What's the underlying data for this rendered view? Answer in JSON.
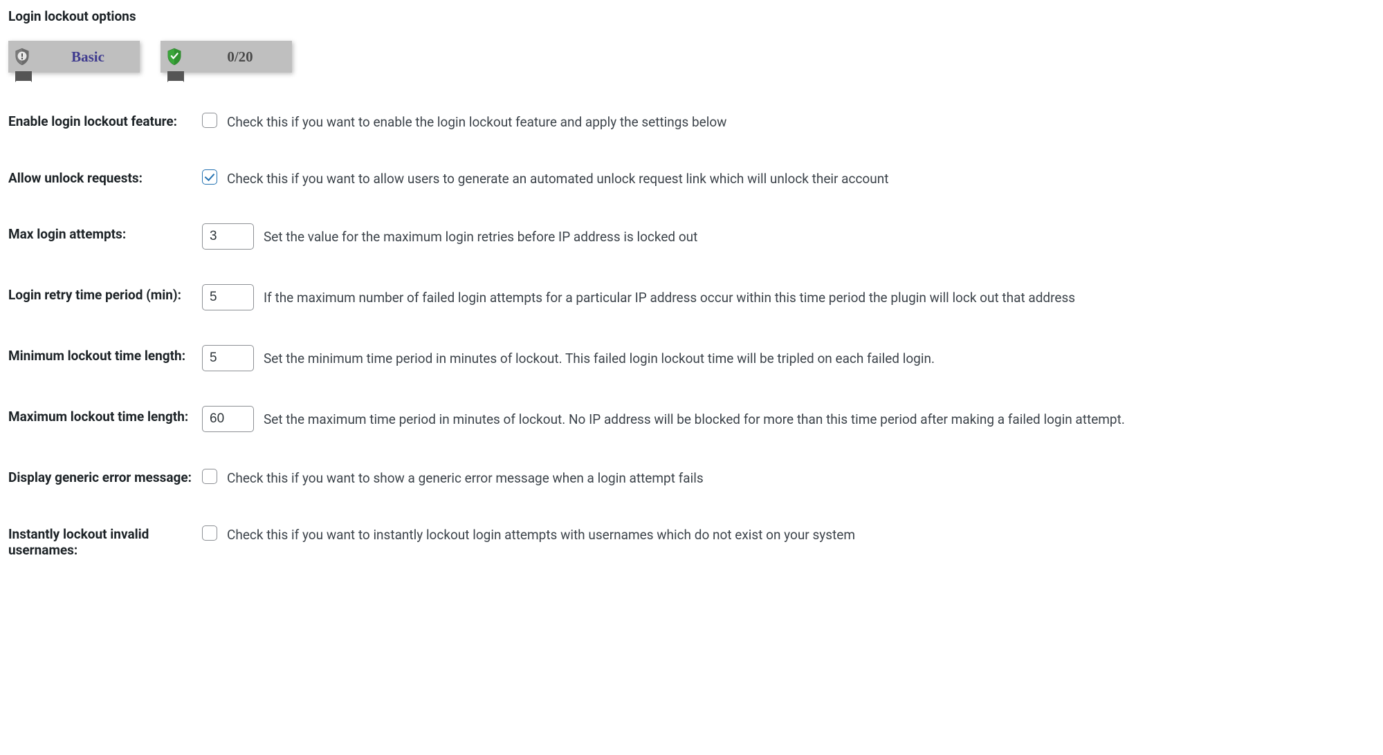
{
  "section_title": "Login lockout options",
  "badges": {
    "basic": {
      "label": "Basic"
    },
    "score": {
      "label": "0/20"
    }
  },
  "rows": {
    "enable_lockout": {
      "label": "Enable login lockout feature:",
      "checked": false,
      "desc": "Check this if you want to enable the login lockout feature and apply the settings below"
    },
    "allow_unlock": {
      "label": "Allow unlock requests:",
      "checked": true,
      "desc": "Check this if you want to allow users to generate an automated unlock request link which will unlock their account"
    },
    "max_attempts": {
      "label": "Max login attempts:",
      "value": "3",
      "desc": "Set the value for the maximum login retries before IP address is locked out"
    },
    "retry_period": {
      "label": "Login retry time period (min):",
      "value": "5",
      "desc": "If the maximum number of failed login attempts for a particular IP address occur within this time period the plugin will lock out that address"
    },
    "min_lockout": {
      "label": "Minimum lockout time length:",
      "value": "5",
      "desc": "Set the minimum time period in minutes of lockout. This failed login lockout time will be tripled on each failed login."
    },
    "max_lockout": {
      "label": "Maximum lockout time length:",
      "value": "60",
      "desc": "Set the maximum time period in minutes of lockout. No IP address will be blocked for more than this time period after making a failed login attempt."
    },
    "generic_error": {
      "label": "Display generic error message:",
      "checked": false,
      "desc": "Check this if you want to show a generic error message when a login attempt fails"
    },
    "instant_lockout": {
      "label": "Instantly lockout invalid usernames:",
      "checked": false,
      "desc": "Check this if you want to instantly lockout login attempts with usernames which do not exist on your system"
    }
  }
}
